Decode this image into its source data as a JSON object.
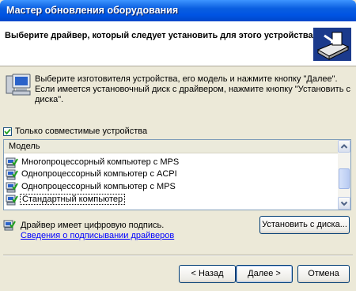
{
  "window": {
    "title": "Мастер обновления оборудования"
  },
  "header": {
    "title": "Выберите драйвер, который следует установить для этого устройства."
  },
  "info": {
    "text": "Выберите изготовителя устройства, его модель и нажмите кнопку \"Далее\". Если имеется установочный диск с драйвером, нажмите кнопку \"Установить с диска\"."
  },
  "compatible": {
    "label": "Только совместимые устройства",
    "checked": true
  },
  "models": {
    "header": "Модель",
    "items": [
      "Многопроцессорный компьютер с MPS",
      "Однопроцессорный компьютер с ACPI",
      "Однопроцессорный компьютер с MPS",
      "Стандартный компьютер"
    ],
    "selected_index": 3
  },
  "signature": {
    "text": "Драйвер имеет цифровую подпись.",
    "link": "Сведения о подписывании драйверов"
  },
  "buttons": {
    "have_disk": "Установить с диска...",
    "back": "< Назад",
    "next": "Далее >",
    "cancel": "Отмена"
  },
  "icons": {
    "header": "hardware-install-icon",
    "info": "computer-icon",
    "signature": "signed-driver-icon",
    "items": "computer-driver-icon"
  }
}
